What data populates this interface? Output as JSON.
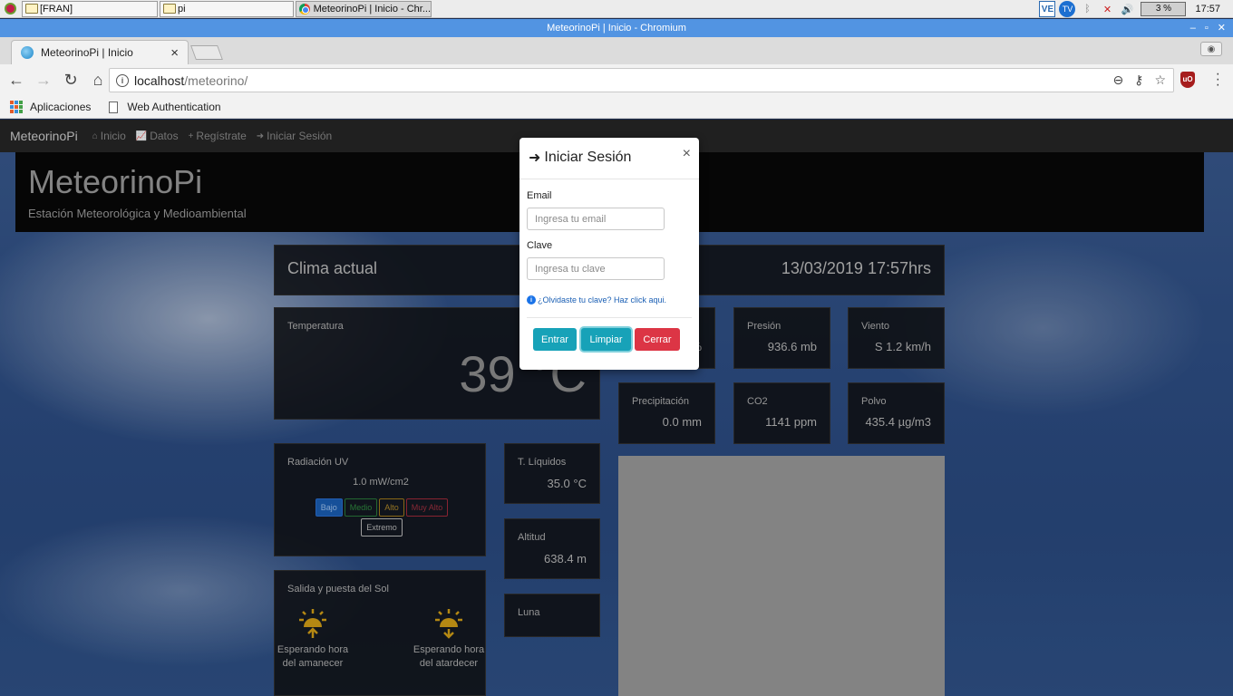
{
  "taskbar": {
    "tasks": [
      "[FRAN]",
      "pi",
      "MeteorinoPi | Inicio - Chr..."
    ],
    "tray": {
      "ve": "VE",
      "tv": "TV",
      "cpu": "3 %",
      "clock": "17:57"
    }
  },
  "window": {
    "title": "MeteorinoPi | Inicio - Chromium",
    "buttons": [
      "–",
      "▫",
      "✕"
    ]
  },
  "browser": {
    "tab_title": "MeteorinoPi | Inicio",
    "tab_close": "×",
    "url_host": "localhost",
    "url_path": "/meteorino/",
    "bookmarks": [
      "Aplicaciones",
      "Web Authentication"
    ]
  },
  "navbar": {
    "brand": "MeteorinoPi",
    "links": [
      {
        "icon": "⌂",
        "label": "Inicio"
      },
      {
        "icon": "📈",
        "label": "Datos"
      },
      {
        "icon": "+",
        "label": "Regístrate"
      },
      {
        "icon": "➜",
        "label": "Iniciar Sesión"
      }
    ]
  },
  "jumbotron": {
    "title": "MeteorinoPi",
    "subtitle": "Estación Meteorológica y Medioambiental"
  },
  "clima": {
    "title": "Clima actual",
    "datetime": "13/03/2019 17:57hrs"
  },
  "temperatura": {
    "title": "Temperatura",
    "value": "39 °C"
  },
  "humedad": {
    "value": "%"
  },
  "presion": {
    "title": "Presión",
    "value": "936.6 mb"
  },
  "viento": {
    "title": "Viento",
    "value": "S 1.2 km/h"
  },
  "precipitacion": {
    "title": "Precipitación",
    "value": "0.0 mm"
  },
  "co2": {
    "title": "CO2",
    "value": "1141 ppm"
  },
  "polvo": {
    "title": "Polvo",
    "value": "435.4 µg/m3"
  },
  "radiacion_uv": {
    "title": "Radiación UV",
    "value": "1.0 mW/cm2",
    "scale": [
      "Bajo",
      "Medio",
      "Alto",
      "Muy Alto",
      "Extremo"
    ],
    "colors": {
      "bajo": "#1a5fb4",
      "medio": "#2f8b3f",
      "alto": "#b08a2a",
      "muy_alto": "#a0303f",
      "extremo": "#bbbbbb"
    }
  },
  "t_liquidos": {
    "title": "T. Líquidos",
    "value": "35.0 °C"
  },
  "altitud": {
    "title": "Altitud",
    "value": "638.4 m"
  },
  "luna": {
    "title": "Luna"
  },
  "sol": {
    "title": "Salida y puesta del Sol",
    "sunrise": "Esperando hora del amanecer",
    "sunset": "Esperando hora del atardecer",
    "icon_color": "#d4a017"
  },
  "modal": {
    "title": "Iniciar Sesión",
    "close": "×",
    "email_label": "Email",
    "email_placeholder": "Ingresa tu email",
    "password_label": "Clave",
    "password_placeholder": "Ingresa tu clave",
    "forgot": "¿Olvidaste tu clave? Haz click aqui.",
    "buttons": {
      "enter": "Entrar",
      "clear": "Limpiar",
      "close": "Cerrar"
    }
  }
}
